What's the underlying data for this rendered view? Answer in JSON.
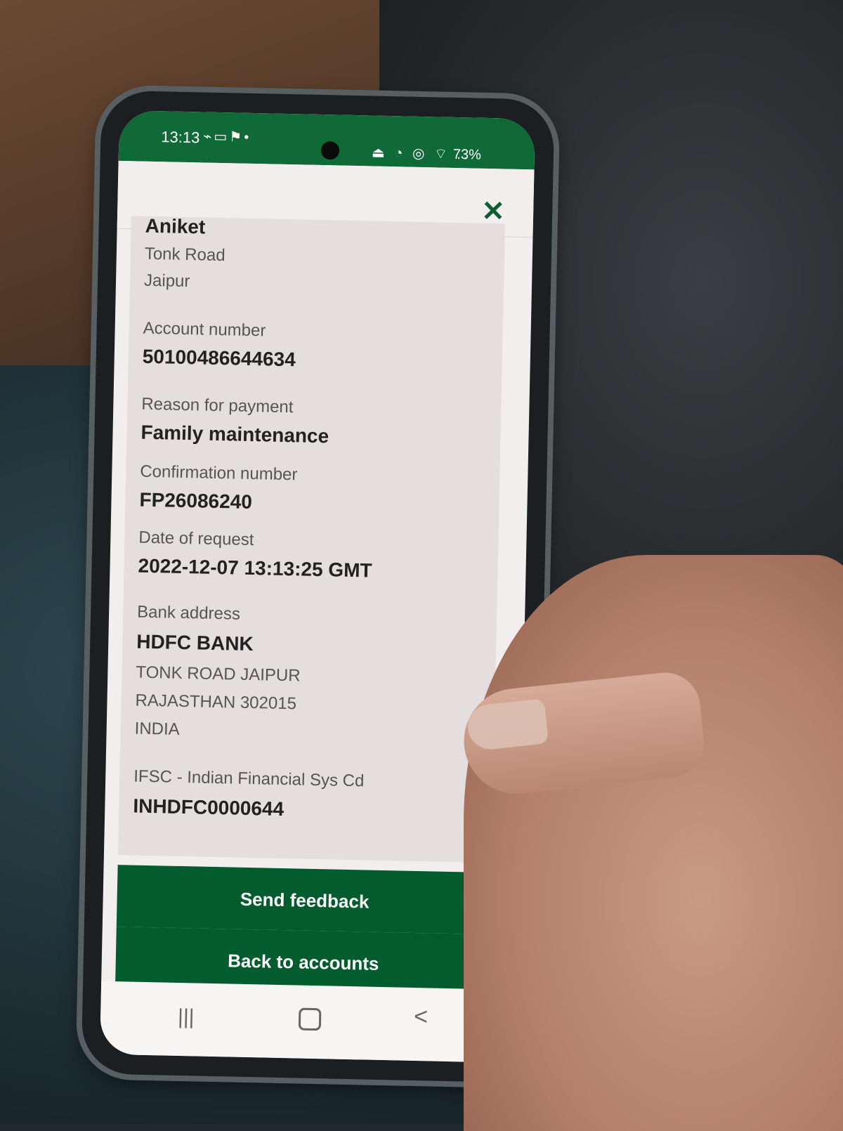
{
  "status": {
    "time": "13:13",
    "left_icons": "⌁▭⚑•",
    "right_icons": "⏏ ◔ ◎ ⌔ ..",
    "battery": "73%"
  },
  "close_icon": "✕",
  "details": {
    "name": "Aniket",
    "address_lines": [
      "Tonk Road",
      "Jaipur"
    ],
    "account_number_label": "Account number",
    "account_number": "50100486644634",
    "reason_label": "Reason for payment",
    "reason": "Family maintenance",
    "confirmation_label": "Confirmation number",
    "confirmation": "FP26086240",
    "date_label": "Date of request",
    "date": "2022-12-07 13:13:25 GMT",
    "bank_address_label": "Bank address",
    "bank_name": "HDFC BANK",
    "bank_lines": [
      "TONK ROAD JAIPUR",
      "RAJASTHAN 302015",
      "INDIA"
    ],
    "ifsc_label": "IFSC - Indian Financial Sys Cd",
    "ifsc": "INHDFC0000644"
  },
  "buttons": {
    "send_feedback": "Send feedback",
    "back_to_accounts": "Back to accounts"
  },
  "nav": {
    "recents": "|||",
    "back": "<"
  },
  "colors": {
    "brand_green": "#0f6a38",
    "button_green": "#035c2e"
  }
}
